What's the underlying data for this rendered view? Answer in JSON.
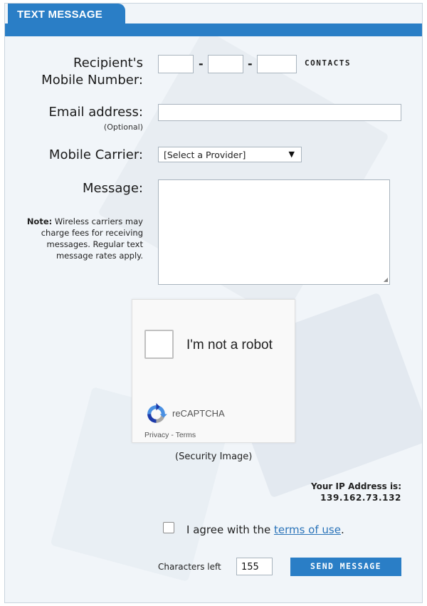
{
  "header": {
    "tab_label": "TEXT MESSAGE"
  },
  "form": {
    "recipient_label_line1": "Recipient's",
    "recipient_label_line2": "Mobile Number:",
    "phone_separator": "-",
    "contacts_link": "CONTACTS",
    "email_label": "Email address:",
    "email_optional": "(Optional)",
    "carrier_label": "Mobile Carrier:",
    "carrier_selected": "[Select a Provider]",
    "message_label": "Message:",
    "note_bold": "Note:",
    "note_text": " Wireless carriers may charge fees for receiving messages. Regular text message rates apply."
  },
  "captcha": {
    "checkbox_text": "I'm not a robot",
    "brand": "reCAPTCHA",
    "privacy_terms": "Privacy - Terms",
    "caption": "(Security Image)"
  },
  "ip": {
    "label": "Your IP Address is:",
    "value": "139.162.73.132"
  },
  "agree": {
    "text": "I agree with the ",
    "link": "terms of use",
    "suffix": "."
  },
  "footer": {
    "chars_left_label": "Characters left",
    "chars_left_value": "155",
    "send_label": "SEND MESSAGE"
  },
  "colors": {
    "accent": "#2a7ec6",
    "link": "#2a73b9"
  }
}
